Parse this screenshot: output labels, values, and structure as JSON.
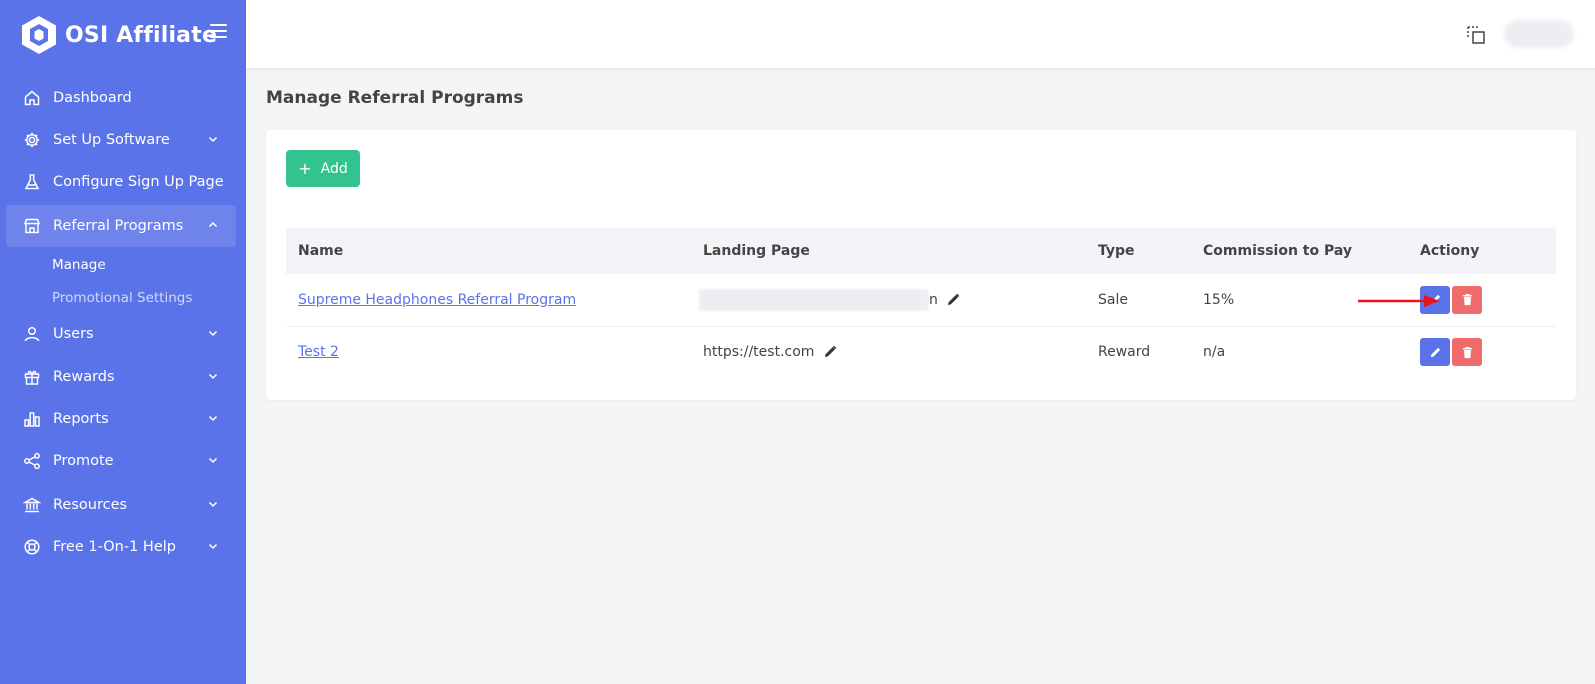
{
  "brand": {
    "name": "OSI Affiliate",
    "logo_icon": "hexagon-logo-icon",
    "menu_icon": "hamburger-icon"
  },
  "sidebar": {
    "items": [
      {
        "label": "Dashboard",
        "icon": "home-icon",
        "chevron": false
      },
      {
        "label": "Set Up Software",
        "icon": "gear-icon",
        "chevron": true
      },
      {
        "label": "Configure Sign Up Page",
        "icon": "flask-icon",
        "chevron": false
      },
      {
        "label": "Referral Programs",
        "icon": "store-icon",
        "chevron": true,
        "expanded": true,
        "active": true
      },
      {
        "label": "Users",
        "icon": "user-icon",
        "chevron": true
      },
      {
        "label": "Rewards",
        "icon": "gift-icon",
        "chevron": true
      },
      {
        "label": "Reports",
        "icon": "bar-chart-icon",
        "chevron": true
      },
      {
        "label": "Promote",
        "icon": "share-icon",
        "chevron": true
      },
      {
        "label": "Resources",
        "icon": "bank-icon",
        "chevron": true
      },
      {
        "label": "Free 1-On-1 Help",
        "icon": "lifebuoy-icon",
        "chevron": true
      }
    ],
    "subitems": [
      {
        "label": "Manage",
        "current": true
      },
      {
        "label": "Promotional Settings",
        "current": false
      }
    ]
  },
  "topbar": {
    "fullscreen_icon": "fullscreen-icon"
  },
  "page": {
    "title": "Manage Referral Programs"
  },
  "toolbar": {
    "add_label": "Add",
    "add_icon": "plus-icon"
  },
  "table": {
    "headers": [
      "Name",
      "Landing Page",
      "Type",
      "Commission to Pay",
      "Actiony"
    ],
    "rows": [
      {
        "name": "Supreme Headphones Referral Program",
        "landing_page": "",
        "landing_suffix": "n",
        "type": "Sale",
        "commission": "15%"
      },
      {
        "name": "Test 2",
        "landing_page": "https://test.com",
        "landing_suffix": "",
        "type": "Reward",
        "commission": "n/a"
      }
    ]
  },
  "colors": {
    "sidebar": "#5b73e8",
    "add_button": "#33c38e",
    "edit_button": "#5b73e8",
    "delete_button": "#f06b6b",
    "annotation_arrow": "#e8161b"
  }
}
